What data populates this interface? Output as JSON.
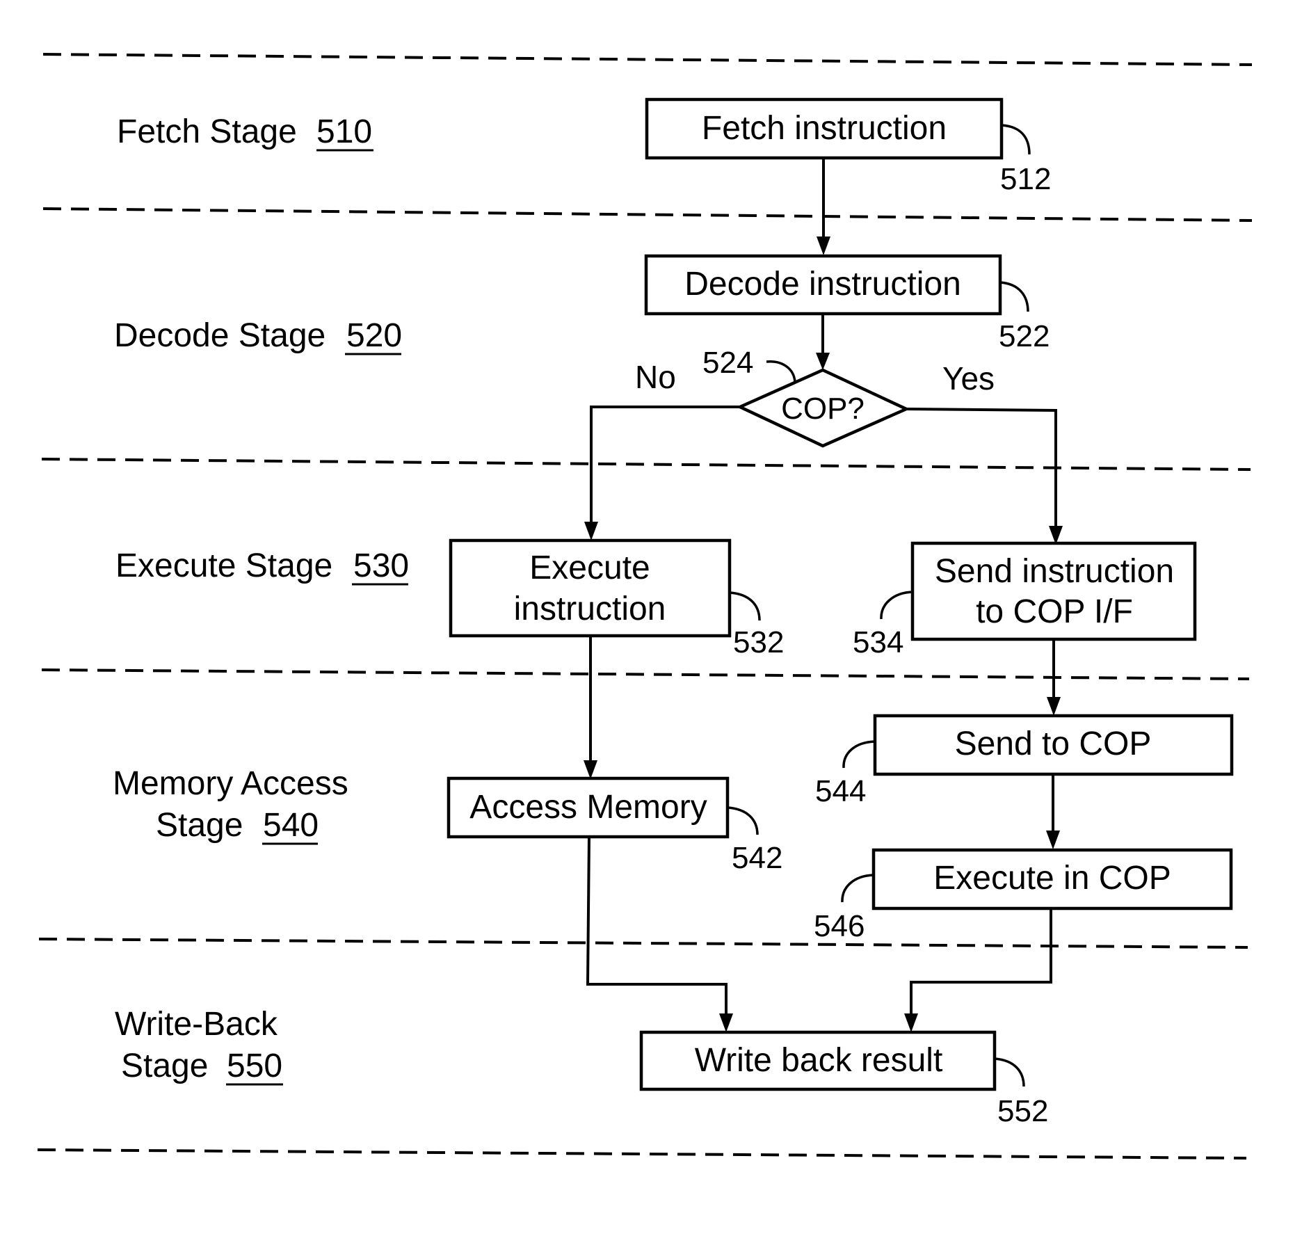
{
  "figure": {
    "stages": [
      {
        "name": "Fetch Stage",
        "ref": "510"
      },
      {
        "name": "Decode Stage",
        "ref": "520"
      },
      {
        "name": "Execute Stage",
        "ref": "530"
      },
      {
        "name_line1": "Memory Access",
        "name_line2": "Stage",
        "ref": "540"
      },
      {
        "name_line1": "Write-Back",
        "name_line2": "Stage",
        "ref": "550"
      }
    ],
    "steps": {
      "fetch": {
        "label": "Fetch instruction",
        "ref": "512"
      },
      "decode": {
        "label": "Decode instruction",
        "ref": "522"
      },
      "decision": {
        "label": "COP?",
        "ref": "524",
        "no_label": "No",
        "yes_label": "Yes"
      },
      "execute": {
        "label_line1": "Execute",
        "label_line2": "instruction",
        "ref": "532"
      },
      "send_instruction": {
        "label_line1": "Send instruction",
        "label_line2": "to COP I/F",
        "ref": "534"
      },
      "access_memory": {
        "label": "Access Memory",
        "ref": "542"
      },
      "send_to_cop": {
        "label": "Send to COP",
        "ref": "544"
      },
      "execute_in_cop": {
        "label": "Execute in COP",
        "ref": "546"
      },
      "write_back": {
        "label": "Write back result",
        "ref": "552"
      }
    }
  }
}
